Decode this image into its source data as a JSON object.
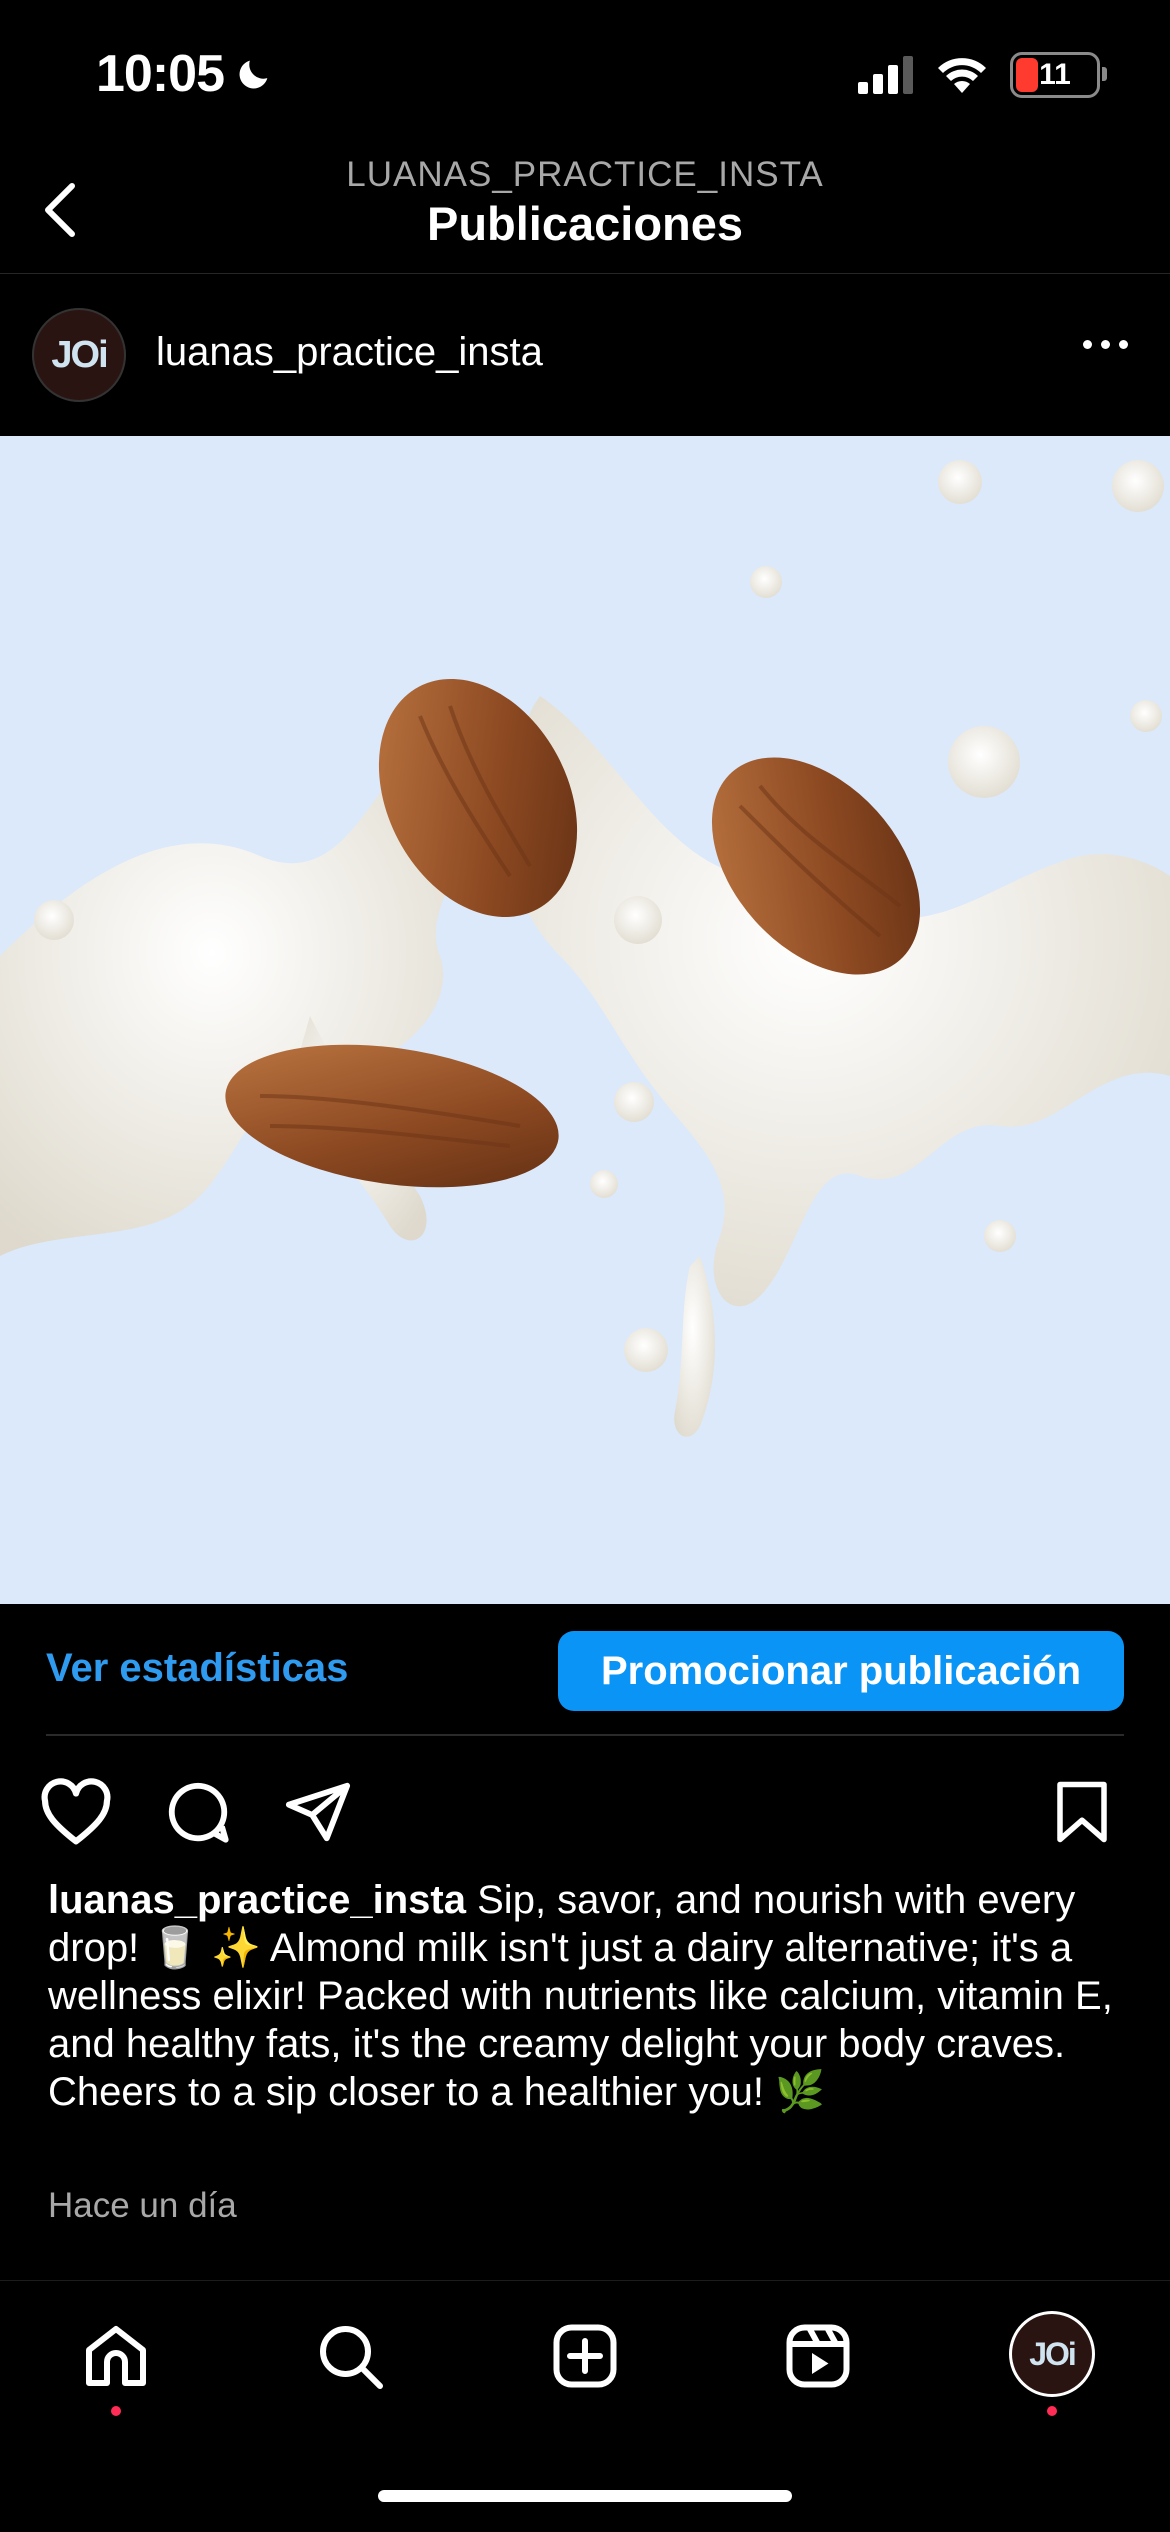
{
  "status_bar": {
    "time": "10:05",
    "battery": "11"
  },
  "header": {
    "subtitle": "LUANAS_PRACTICE_INSTA",
    "title": "Publicaciones"
  },
  "post": {
    "username": "luanas_practice_insta",
    "avatar_text": "JOi",
    "image_alt": "almonds in milk splash",
    "actions": {
      "stats_link": "Ver estadísticas",
      "promote_button": "Promocionar publicación"
    },
    "caption": {
      "username": "luanas_practice_insta",
      "text": "Sip, savor, and nourish with every drop! 🥛 ✨ Almond milk isn't just a dairy alternative; it's a wellness elixir! Packed with nutrients like calcium, vitamin E, and healthy fats, it's the creamy delight your body craves. Cheers to a sip closer to a healthier you! 🌿"
    },
    "timestamp": "Hace un día"
  },
  "bottom_nav": {
    "items": [
      "home-icon",
      "search-icon",
      "create-icon",
      "reels-icon",
      "profile-avatar"
    ],
    "avatar_text": "JOi"
  },
  "colors": {
    "accent": "#0a95f6",
    "link": "#2e9bf0",
    "notification": "#ff2d55",
    "image_bg": "#dbe9fb"
  }
}
